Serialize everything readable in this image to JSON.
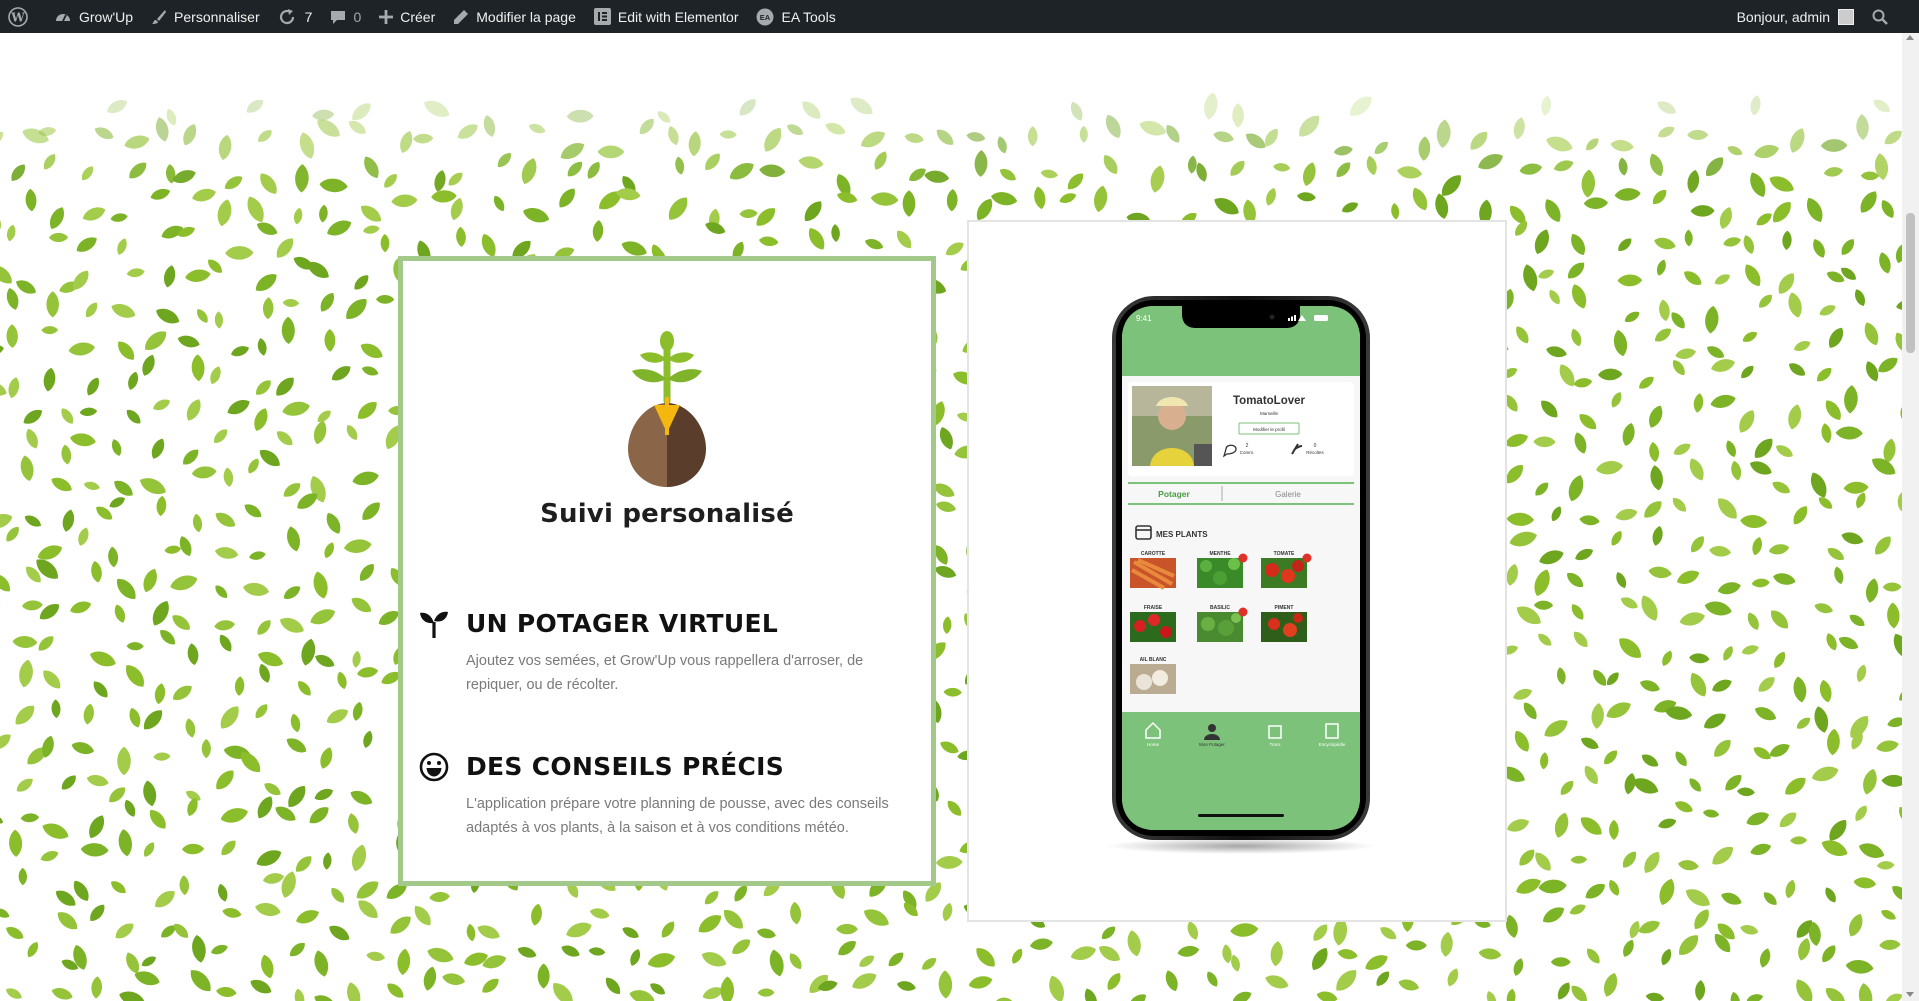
{
  "adminbar": {
    "site_name": "Grow'Up",
    "customize": "Personnaliser",
    "updates_count": "7",
    "comments_count": "0",
    "new": "Créer",
    "edit_page": "Modifier la page",
    "elementor": "Edit with Elementor",
    "ea_tools": "EA Tools",
    "greeting": "Bonjour, admin"
  },
  "feature_card": {
    "title": "Suivi personalisé",
    "features": [
      {
        "icon": "seedling-icon",
        "heading": "UN POTAGER VIRTUEL",
        "text": "Ajoutez vos semées, et Grow'Up vous rappellera d'arroser, de repiquer, ou de récolter."
      },
      {
        "icon": "smile-icon",
        "heading": "DES CONSEILS PRÉCIS",
        "text": "L'application prépare votre planning de pousse, avec des conseils adaptés à vos plants, à la saison et à vos conditions météo."
      }
    ]
  },
  "phone": {
    "time": "9:41",
    "username": "TomatoLover",
    "city": "Marseille",
    "edit_profile": "Modifier le profil",
    "stat_comments_value": "2",
    "stat_comments_label": "Comm.",
    "stat_harvest_value": "0",
    "stat_harvest_label": "Récoltes",
    "tabs": [
      "Potager",
      "Galerie"
    ],
    "section_title": "MES PLANTS",
    "plants": [
      "CAROTTE",
      "MENTHE",
      "TOMATE",
      "FRAISE",
      "BASILIC",
      "PIMENT",
      "AIL BLANC"
    ],
    "nav": [
      "Home",
      "Mon Potager",
      "Trocs",
      "Encyclopédie"
    ]
  },
  "colors": {
    "adminbar_bg": "#1d2327",
    "leaf_green": "#8cbd2a",
    "card_border": "#a3c98a",
    "app_green": "#7dc27a"
  }
}
